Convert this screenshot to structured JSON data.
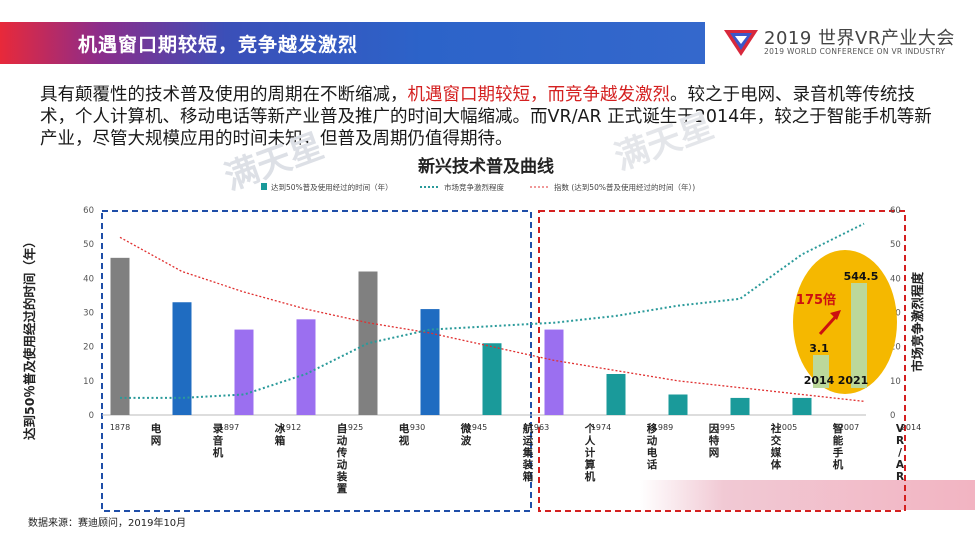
{
  "header": {
    "title": "机遇窗口期较短，竞争越发激烈"
  },
  "logo": {
    "text": "2019 世界VR产业大会",
    "subtitle": "2019 WORLD CONFERENCE ON VR INDUSTRY"
  },
  "paragraph": {
    "part1": "具有颠覆性的技术普及使用的周期在不断缩减，",
    "highlight": "机遇窗口期较短，而竞争越发激烈",
    "part2": "。较之于电网、录音机等传统技术，个人计算机、移动电话等新产业普及推广的时间大幅缩减。而VR/AR 正式诞生于2014年，较之于智能手机等新产业，尽管大规模应用的时间未知，但普及周期仍值得期待。"
  },
  "source": "数据来源：赛迪顾问，2019年10月",
  "colors": {
    "grey": "#808080",
    "blue": "#1f6cc1",
    "purple": "#9b6ff0",
    "teal": "#1a9a9a",
    "red_line": "#e03030",
    "green_line": "#2a9a9a",
    "box_blue": "#1f4ea8",
    "box_red": "#d42020",
    "bubble": "#f5b800",
    "bubble_bar": "#bcd89a",
    "arrow": "#cc1010"
  },
  "chart_data": {
    "type": "bar",
    "title": "新兴技术普及曲线",
    "ylabel": "达到50％普及使用经过的时间（年）",
    "y2label": "市场竞争激烈程度",
    "ylim": [
      0,
      60
    ],
    "y2lim": [
      0,
      60
    ],
    "yticks": [
      0,
      10,
      20,
      30,
      40,
      50,
      60
    ],
    "y2ticks": [
      0,
      10,
      20,
      30,
      40,
      50,
      60
    ],
    "legend": [
      "达到50%普及使用经过的时间（年）",
      "市场竞争激烈程度",
      "指数 (达到50%普及使用经过的时间（年）)"
    ],
    "legend_position": "top",
    "years": [
      "1878",
      "1897",
      "1912",
      "1925",
      "1930",
      "1945",
      "1963",
      "1974",
      "1989",
      "1995",
      "2005",
      "2007",
      "2014"
    ],
    "categories": [
      "电网",
      "录音机",
      "冰箱",
      "自动传动装置",
      "电视",
      "微波",
      "航运集装箱",
      "个人计算机",
      "移动电话",
      "因特网",
      "社交媒体",
      "智能手机",
      "VR/AR"
    ],
    "values": [
      46,
      33,
      25,
      28,
      42,
      31,
      21,
      25,
      12,
      6,
      5,
      5,
      null
    ],
    "bar_colors": [
      "grey",
      "blue",
      "purple",
      "purple",
      "grey",
      "blue",
      "teal",
      "purple",
      "teal",
      "teal",
      "teal",
      "teal",
      null
    ],
    "competition_line": [
      5,
      5,
      6,
      12,
      21,
      25,
      26,
      27,
      29,
      32,
      34,
      47,
      56
    ],
    "trend_line": [
      52,
      42,
      36,
      31,
      27,
      24,
      20,
      16,
      13,
      10,
      8,
      6,
      4
    ],
    "inset": {
      "years": [
        "2014",
        "2021"
      ],
      "values": [
        3.1,
        544.5
      ],
      "value_labels": [
        "3.1",
        "544.5"
      ],
      "multiplier": "175倍"
    }
  }
}
